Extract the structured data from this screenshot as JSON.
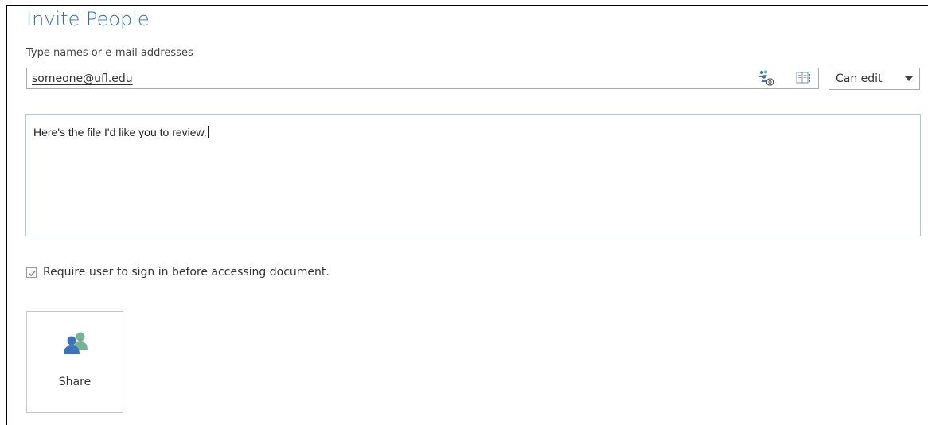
{
  "title": "Invite People",
  "invite": {
    "field_label": "Type names or e-mail addresses",
    "email_value": "someone@ufl.edu",
    "permission": "Can edit"
  },
  "message": {
    "text": "Here's the file I'd like you to review."
  },
  "require_signin": {
    "checked": true,
    "label": "Require user to sign in before accessing document."
  },
  "share": {
    "label": "Share"
  },
  "icons": {
    "check_address": "check-names-icon",
    "address_book": "address-book-icon",
    "share": "people-icon",
    "dropdown": "chevron-down-icon"
  },
  "colors": {
    "title": "#2b6fb5",
    "person_blue": "#3a73c0",
    "person_green": "#74b58f"
  }
}
